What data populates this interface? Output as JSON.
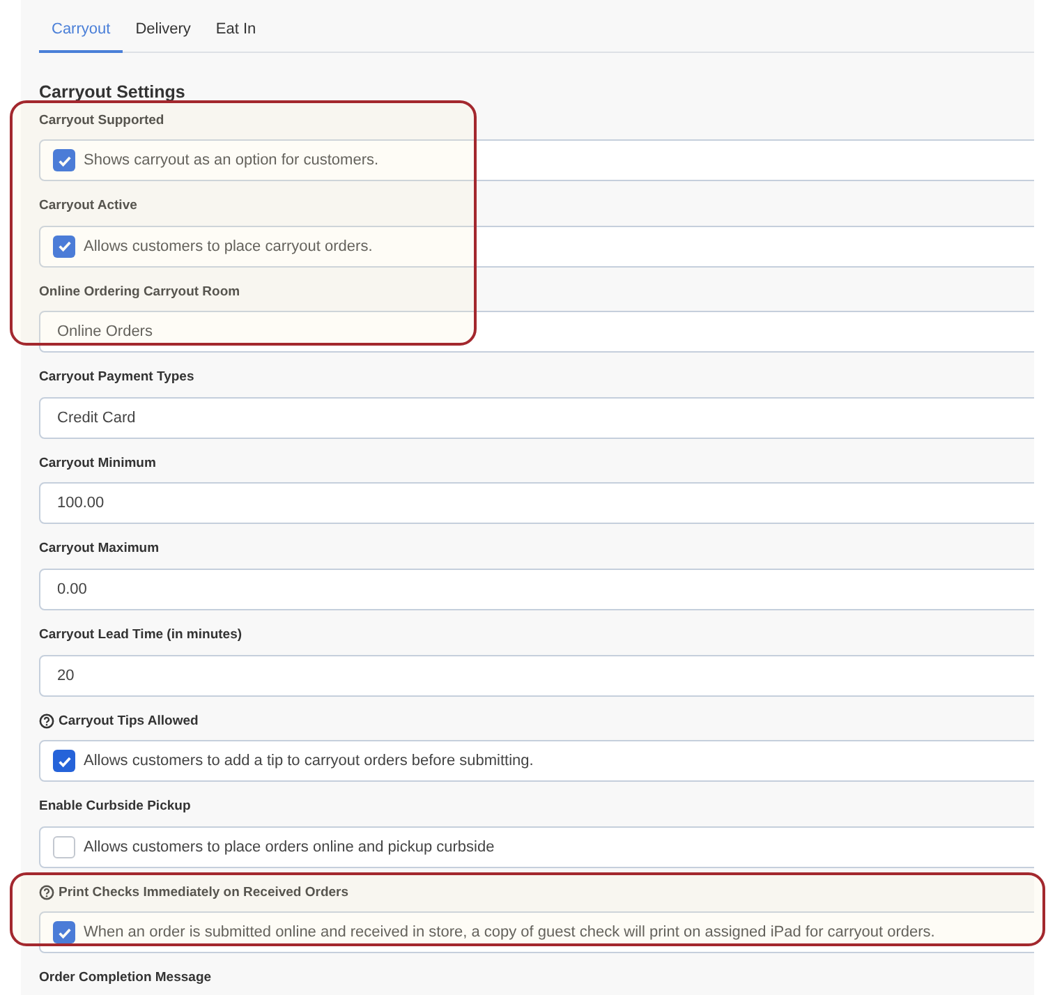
{
  "highlight_frames": [
    {
      "kind": "narrow"
    },
    {
      "kind": "wide"
    }
  ],
  "tabs": [
    {
      "label": "Carryout",
      "selected": true
    },
    {
      "label": "Delivery",
      "selected": false
    },
    {
      "label": "Eat In",
      "selected": false
    }
  ],
  "section_title": "Carryout Settings",
  "fields": [
    {
      "label": "Carryout Supported",
      "kind": "checkbox",
      "checked": true,
      "text": "Shows carryout as an option for customers.",
      "highlighted": true
    },
    {
      "label": "Carryout Active",
      "kind": "checkbox",
      "checked": true,
      "text": "Allows customers to place carryout orders.",
      "highlighted": true
    },
    {
      "label": "Online Ordering Carryout Room",
      "kind": "text",
      "value": "Online Orders",
      "highlighted": true
    },
    {
      "label": "Carryout Payment Types",
      "kind": "text",
      "value": "Credit Card"
    },
    {
      "label": "Carryout Minimum",
      "kind": "text",
      "value": "100.00"
    },
    {
      "label": "Carryout Maximum",
      "kind": "text",
      "value": "0.00"
    },
    {
      "label": "Carryout Lead Time (in minutes)",
      "kind": "text",
      "value": "20"
    },
    {
      "label": "Carryout Tips Allowed",
      "help": true,
      "kind": "checkbox",
      "checked": true,
      "text": "Allows customers to add a tip to carryout orders before submitting."
    },
    {
      "label": "Enable Curbside Pickup",
      "kind": "checkbox",
      "checked": false,
      "text": "Allows customers to place orders online and pickup curbside"
    },
    {
      "label": "Print Checks Immediately on Received Orders",
      "help": true,
      "kind": "checkbox",
      "checked": true,
      "text": "When an order is submitted online and received in store, a copy of guest check will print on assigned iPad for carryout orders.",
      "highlighted": true
    },
    {
      "label": "Order Completion Message",
      "kind": "label"
    }
  ]
}
